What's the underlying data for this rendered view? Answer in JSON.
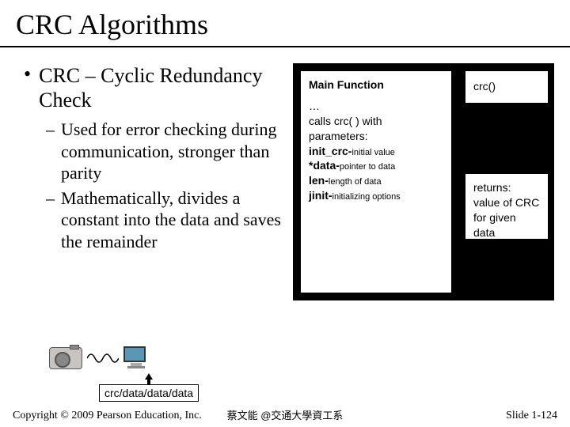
{
  "title": "CRC Algorithms",
  "bullet": {
    "main": "CRC – Cyclic Redundancy Check",
    "sub1": "Used for error checking during communication, stronger than parity",
    "sub2": "Mathematically, divides a constant into the data and saves the remainder"
  },
  "boxes": {
    "main_title": "Main Function",
    "main_ellipsis": "…",
    "main_calls": "calls crc( ) with parameters:",
    "p_initcrc_b": "init_crc-",
    "p_initcrc_s": "initial value",
    "p_data_b": "*data-",
    "p_data_s": "pointer to data",
    "p_len_b": "len-",
    "p_len_s": "length of data",
    "p_jinit_b": "jinit-",
    "p_jinit_s": "initializing options",
    "crc_label": "crc()",
    "ret_label": "returns:",
    "ret_body": "value of CRC for given data"
  },
  "diagram": {
    "data_label": "crc/data/data/data"
  },
  "footer": {
    "copyright": "Copyright © 2009 Pearson Education, Inc.",
    "center": "蔡文能 @交通大學資工系",
    "slide": "Slide 1-124"
  }
}
